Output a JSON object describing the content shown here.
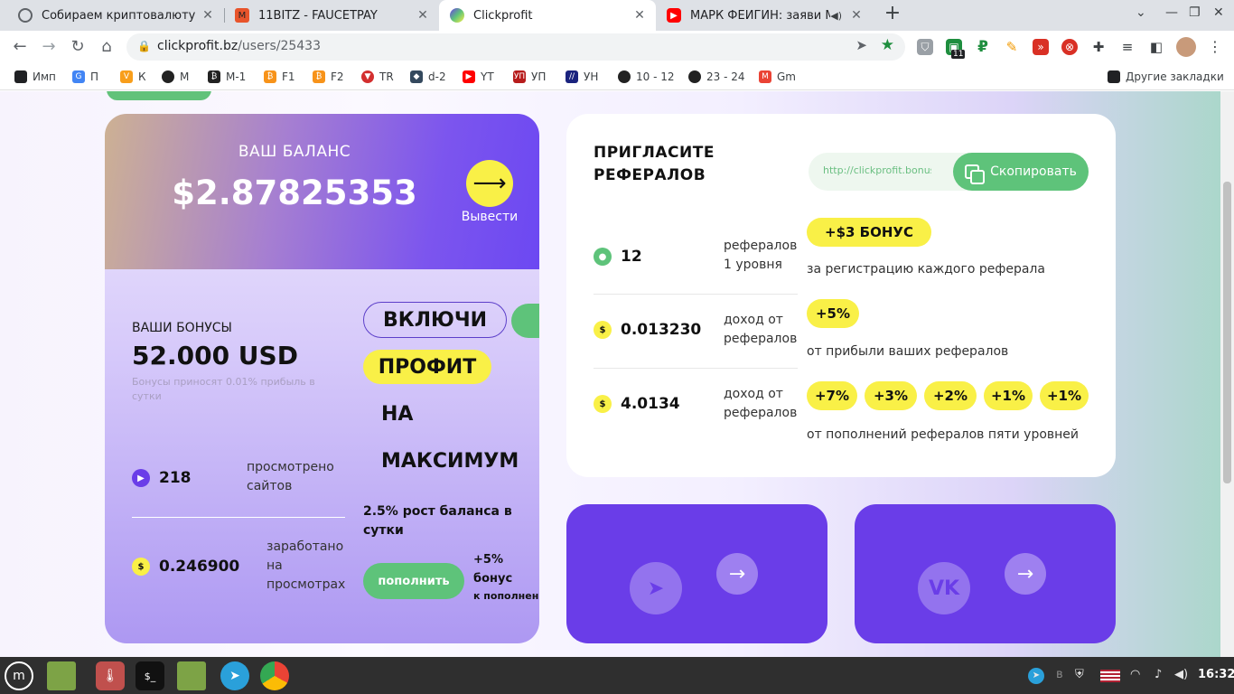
{
  "browser": {
    "tabs": [
      {
        "title": "Собираем криптовалюту",
        "favicon": "globe-icon",
        "color": "#5f6368"
      },
      {
        "title": "11BITZ - FAUCETPAY",
        "favicon": "faucetpay-icon",
        "color": "#e8542b"
      },
      {
        "title": "Clickprofit",
        "favicon": "clickprofit-icon",
        "color": "#6a3de8"
      },
      {
        "title": "МАРК ФЕЙГИН: заяви Ме",
        "favicon": "youtube-icon",
        "color": "#ff0000"
      }
    ],
    "new_tab": "+",
    "url_host": "clickprofit.bz",
    "url_path": "/users/25433",
    "extension_badge": "11"
  },
  "bookmarks": [
    {
      "label": "Имп",
      "color": "#000000"
    },
    {
      "label": "П",
      "color": "#4285f4"
    },
    {
      "label": "К",
      "color": "#f89e1b"
    },
    {
      "label": "М",
      "color": "#222222"
    },
    {
      "label": "М-1",
      "color": "#222222"
    },
    {
      "label": "F1",
      "color": "#f7931a"
    },
    {
      "label": "F2",
      "color": "#f7931a"
    },
    {
      "label": "TR",
      "color": "#d32f2f"
    },
    {
      "label": "d-2",
      "color": "#34495e"
    },
    {
      "label": "YT",
      "color": "#ff0000"
    },
    {
      "label": "УП",
      "color": "#b71c1c"
    },
    {
      "label": "УН",
      "color": "#1a237e"
    },
    {
      "label": "10 - 12",
      "color": "#222222"
    },
    {
      "label": "23 - 24",
      "color": "#222222"
    },
    {
      "label": "Gm",
      "color": "#ea4335"
    }
  ],
  "other_bookmarks": "Другие закладки",
  "balance": {
    "label": "ВАШ БАЛАНС",
    "value": "$2.87825353",
    "withdraw": "Вывести"
  },
  "bonuses": {
    "heading": "ВАШИ БОНУСЫ",
    "value": "52.000 USD",
    "note": "Бонусы приносят 0.01% прибыль в сутки"
  },
  "stats": [
    {
      "value": "218",
      "label": "просмотрено сайтов"
    },
    {
      "value": "0.246900",
      "label": "заработано на просмотрах"
    }
  ],
  "promo": {
    "line1": "ВКЛЮЧИ",
    "line2": "ПРОФИТ",
    "line3": "НА",
    "line4": "МАКСИМУМ",
    "growth": "2.5% рост баланса в сутки",
    "topup_button": "пополнить",
    "topup_bonus": "+5% бонус",
    "topup_bonus_sub": "к пополнени"
  },
  "referrals": {
    "title": "ПРИГЛАСИТЕ РЕФЕРАЛОВ",
    "link": "http://clickprofit.bonus",
    "copy_button": "Скопировать",
    "rows": [
      {
        "value": "12",
        "label": "рефералов 1 уровня"
      },
      {
        "value": "0.013230",
        "label": "доход от рефералов"
      },
      {
        "value": "4.0134",
        "label": "доход от рефералов"
      }
    ],
    "bonus1": "+$3 БОНУС",
    "bonus1_sub": "за регистрацию каждого реферала",
    "bonus2": "+5%",
    "bonus2_sub": "от прибыли ваших рефералов",
    "levels": [
      "+7%",
      "+3%",
      "+2%",
      "+1%",
      "+1%"
    ],
    "levels_sub": "от пополнений рефералов пяти уровней"
  },
  "socials": [
    {
      "icon": "telegram-icon",
      "glyph": "➤"
    },
    {
      "icon": "vk-icon",
      "glyph": "VK"
    }
  ],
  "taskbar": {
    "clock": "16:32"
  },
  "colors": {
    "accent_purple": "#6a3de8",
    "accent_green": "#5ec37a",
    "accent_yellow": "#f9f047"
  }
}
